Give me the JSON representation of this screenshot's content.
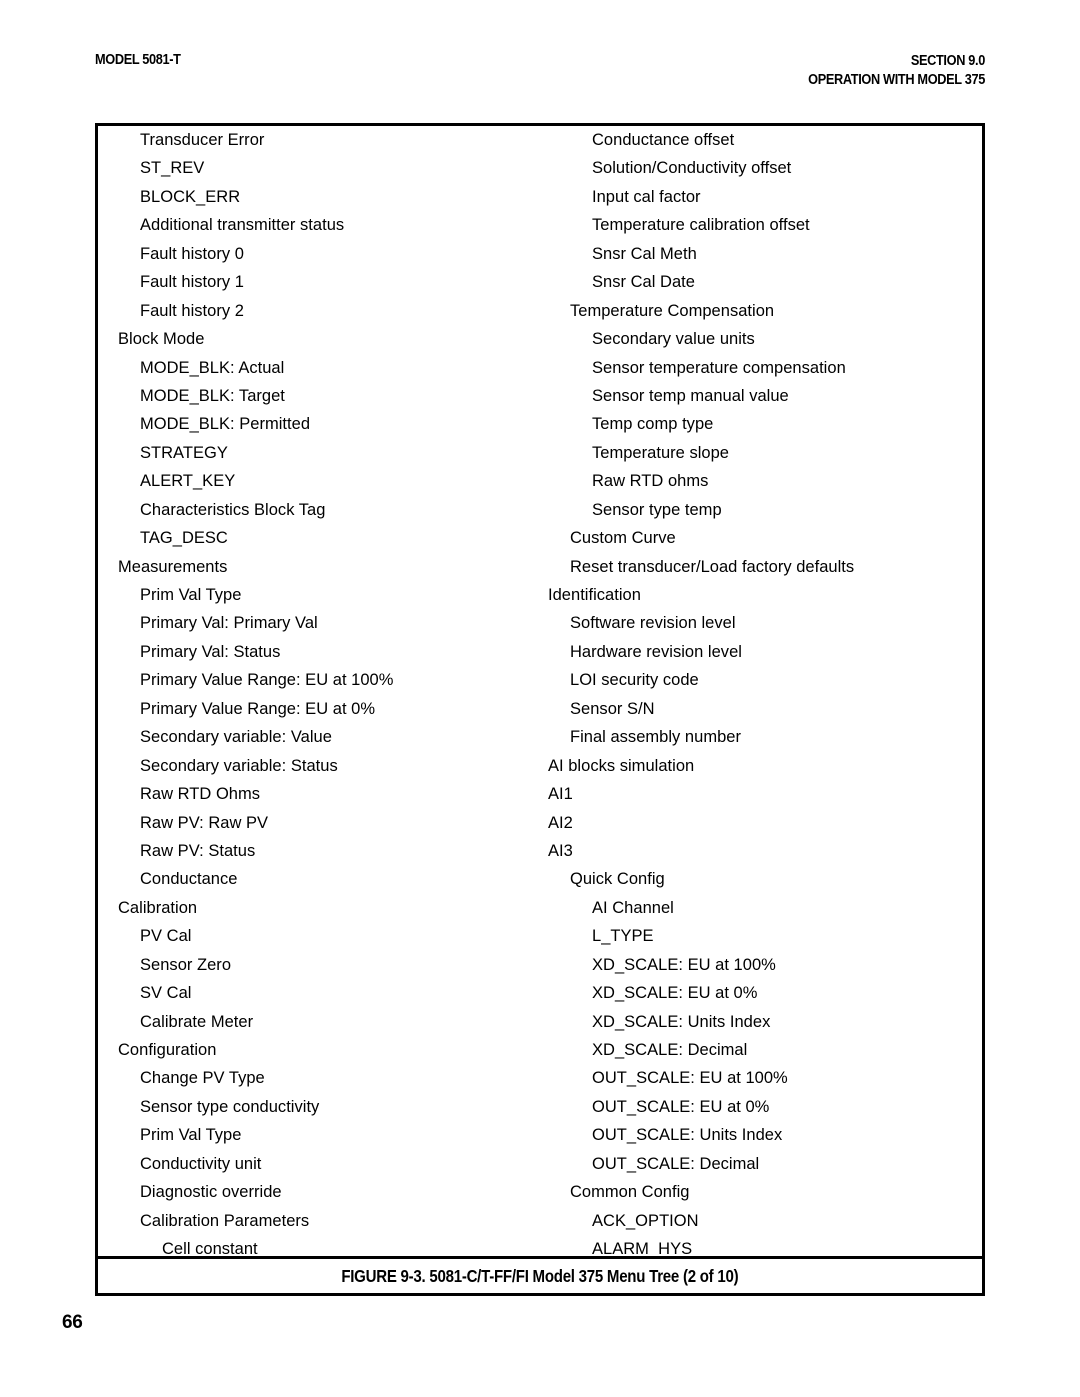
{
  "header": {
    "model": "MODEL 5081-T",
    "section": "SECTION 9.0",
    "section_subtitle": "OPERATION WITH MODEL 375"
  },
  "figure": {
    "caption": "FIGURE 9-3. 5081-C/T-FF/FI Model 375 Menu Tree (2 of 10)"
  },
  "page": {
    "number": "66"
  },
  "menu_tree": {
    "left_column": [
      {
        "label": "Transducer Error",
        "level": 1
      },
      {
        "label": "ST_REV",
        "level": 1
      },
      {
        "label": "BLOCK_ERR",
        "level": 1
      },
      {
        "label": "Additional transmitter status",
        "level": 1
      },
      {
        "label": "Fault history 0",
        "level": 1
      },
      {
        "label": "Fault history 1",
        "level": 1
      },
      {
        "label": "Fault history 2",
        "level": 1
      },
      {
        "label": "Block Mode",
        "level": 0
      },
      {
        "label": "MODE_BLK: Actual",
        "level": 1
      },
      {
        "label": "MODE_BLK: Target",
        "level": 1
      },
      {
        "label": "MODE_BLK: Permitted",
        "level": 1
      },
      {
        "label": "STRATEGY",
        "level": 1
      },
      {
        "label": "ALERT_KEY",
        "level": 1
      },
      {
        "label": "Characteristics Block Tag",
        "level": 1
      },
      {
        "label": "TAG_DESC",
        "level": 1
      },
      {
        "label": "Measurements",
        "level": 0
      },
      {
        "label": "Prim Val Type",
        "level": 1
      },
      {
        "label": "Primary Val: Primary Val",
        "level": 1
      },
      {
        "label": "Primary Val: Status",
        "level": 1
      },
      {
        "label": "Primary Value Range: EU at 100%",
        "level": 1
      },
      {
        "label": "Primary Value Range: EU at 0%",
        "level": 1
      },
      {
        "label": "Secondary variable: Value",
        "level": 1
      },
      {
        "label": "Secondary variable: Status",
        "level": 1
      },
      {
        "label": "Raw RTD Ohms",
        "level": 1
      },
      {
        "label": "Raw PV: Raw PV",
        "level": 1
      },
      {
        "label": "Raw PV: Status",
        "level": 1
      },
      {
        "label": "Conductance",
        "level": 1
      },
      {
        "label": "Calibration",
        "level": 0
      },
      {
        "label": "PV Cal",
        "level": 1
      },
      {
        "label": "Sensor Zero",
        "level": 1
      },
      {
        "label": "SV Cal",
        "level": 1
      },
      {
        "label": "Calibrate Meter",
        "level": 1
      },
      {
        "label": "Configuration",
        "level": 0
      },
      {
        "label": "Change PV Type",
        "level": 1
      },
      {
        "label": "Sensor type conductivity",
        "level": 1
      },
      {
        "label": "Prim Val Type",
        "level": 1
      },
      {
        "label": "Conductivity unit",
        "level": 1
      },
      {
        "label": "Diagnostic override",
        "level": 1
      },
      {
        "label": "Calibration Parameters",
        "level": 1
      },
      {
        "label": "Cell constant",
        "level": 2
      }
    ],
    "right_column": [
      {
        "label": "Conductance offset",
        "level": 2
      },
      {
        "label": "Solution/Conductivity offset",
        "level": 2
      },
      {
        "label": "Input cal factor",
        "level": 2
      },
      {
        "label": "Temperature calibration offset",
        "level": 2
      },
      {
        "label": "Snsr Cal Meth",
        "level": 2
      },
      {
        "label": "Snsr Cal Date",
        "level": 2
      },
      {
        "label": "Temperature Compensation",
        "level": 1
      },
      {
        "label": "Secondary value units",
        "level": 2
      },
      {
        "label": "Sensor temperature compensation",
        "level": 2
      },
      {
        "label": "Sensor temp manual value",
        "level": 2
      },
      {
        "label": "Temp comp type",
        "level": 2
      },
      {
        "label": "Temperature slope",
        "level": 2
      },
      {
        "label": "Raw RTD ohms",
        "level": 2
      },
      {
        "label": "Sensor type temp",
        "level": 2
      },
      {
        "label": "Custom Curve",
        "level": 1
      },
      {
        "label": "Reset transducer/Load factory defaults",
        "level": 1
      },
      {
        "label": "Identification",
        "level": 0
      },
      {
        "label": "Software revision level",
        "level": 1
      },
      {
        "label": "Hardware revision level",
        "level": 1
      },
      {
        "label": "LOI security code",
        "level": 1
      },
      {
        "label": "Sensor S/N",
        "level": 1
      },
      {
        "label": "Final assembly number",
        "level": 1
      },
      {
        "label": "AI blocks simulation",
        "level": 0
      },
      {
        "label": "AI1",
        "level": 0
      },
      {
        "label": "AI2",
        "level": 0
      },
      {
        "label": "AI3",
        "level": 0
      },
      {
        "label": "Quick Config",
        "level": 1
      },
      {
        "label": "AI Channel",
        "level": 2
      },
      {
        "label": "L_TYPE",
        "level": 2
      },
      {
        "label": "XD_SCALE: EU at 100%",
        "level": 2
      },
      {
        "label": "XD_SCALE: EU at 0%",
        "level": 2
      },
      {
        "label": "XD_SCALE: Units Index",
        "level": 2
      },
      {
        "label": "XD_SCALE: Decimal",
        "level": 2
      },
      {
        "label": "OUT_SCALE: EU at 100%",
        "level": 2
      },
      {
        "label": "OUT_SCALE: EU at 0%",
        "level": 2
      },
      {
        "label": "OUT_SCALE: Units Index",
        "level": 2
      },
      {
        "label": "OUT_SCALE: Decimal",
        "level": 2
      },
      {
        "label": "Common Config",
        "level": 1
      },
      {
        "label": "ACK_OPTION",
        "level": 2
      },
      {
        "label": "ALARM_HYS",
        "level": 2
      }
    ]
  }
}
